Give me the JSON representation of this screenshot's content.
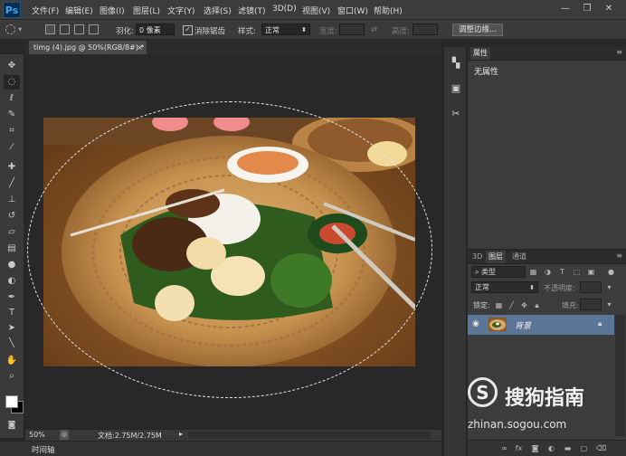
{
  "app": {
    "logo": "Ps"
  },
  "menu": [
    "文件(F)",
    "编辑(E)",
    "图像(I)",
    "图层(L)",
    "文字(Y)",
    "选择(S)",
    "滤镜(T)",
    "3D(D)",
    "视图(V)",
    "窗口(W)",
    "帮助(H)"
  ],
  "window_controls": {
    "minimize": "—",
    "restore": "❐",
    "close": "✕"
  },
  "options": {
    "feather_label": "羽化:",
    "feather_value": "0 像素",
    "antialias_label": "消除锯齿",
    "antialias_checked": true,
    "style_label": "样式:",
    "style_value": "正常",
    "width_label": "宽度:",
    "height_label": "高度:",
    "refine_button": "调整边缘..."
  },
  "document": {
    "tab_title": "timg (4).jpg @ 50%(RGB/8#) *",
    "tab_close": "×"
  },
  "status": {
    "zoom": "50%",
    "doc_info": "文档:2.75M/2.75M"
  },
  "timeline": {
    "label": "时间轴"
  },
  "properties_panel": {
    "tab": "属性",
    "content": "无属性"
  },
  "layers_panel": {
    "tabs": [
      "3D",
      "图层",
      "通道"
    ],
    "active_tab": "图层",
    "filter_label": "类型",
    "blend_mode": "正常",
    "opacity_label": "不透明度:",
    "lock_label": "锁定:",
    "fill_label": "填充:",
    "layer_name": "背景"
  },
  "watermark": {
    "logo_letter": "S",
    "title": "搜狗指南",
    "url": "zhinan.sogou.com"
  },
  "icons": {
    "tools": [
      "move-icon",
      "elliptical-marquee-icon",
      "lasso-icon",
      "quick-select-icon",
      "crop-icon",
      "eyedropper-icon",
      "healing-brush-icon",
      "brush-icon",
      "clone-stamp-icon",
      "history-brush-icon",
      "eraser-icon",
      "gradient-icon",
      "blur-icon",
      "dodge-icon",
      "pen-icon",
      "type-icon",
      "path-select-icon",
      "line-icon",
      "hand-icon",
      "zoom-icon"
    ]
  }
}
